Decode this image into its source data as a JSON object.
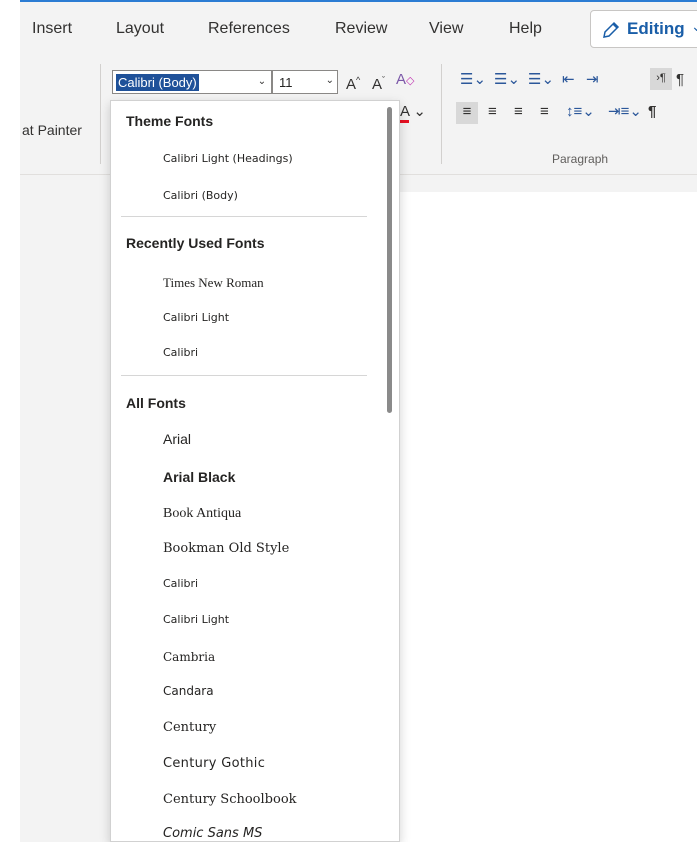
{
  "tabs": [
    "Insert",
    "Layout",
    "References",
    "Review",
    "View",
    "Help"
  ],
  "editing": {
    "label": "Editing",
    "icon": "pencil-icon"
  },
  "ribbon": {
    "format_painter": "at Painter",
    "font_name": "Calibri (Body)",
    "font_size": "11",
    "paragraph_label": "Paragraph"
  },
  "dropdown": {
    "theme_header": "Theme Fonts",
    "theme_fonts": [
      "Calibri Light (Headings)",
      "Calibri (Body)"
    ],
    "recent_header": "Recently Used Fonts",
    "recent_fonts": [
      "Times New Roman",
      "Calibri Light",
      "Calibri"
    ],
    "all_header": "All Fonts",
    "all_fonts": [
      "Arial",
      "Arial Black",
      "Book Antiqua",
      "Bookman Old Style",
      "Calibri",
      "Calibri Light",
      "Cambria",
      "Candara",
      "Century",
      "Century Gothic",
      "Century Schoolbook",
      "Comic Sans MS"
    ]
  },
  "colors": {
    "accent": "#2b7cd3",
    "selection": "#1f5199",
    "editing_text": "#1a5ea8"
  }
}
